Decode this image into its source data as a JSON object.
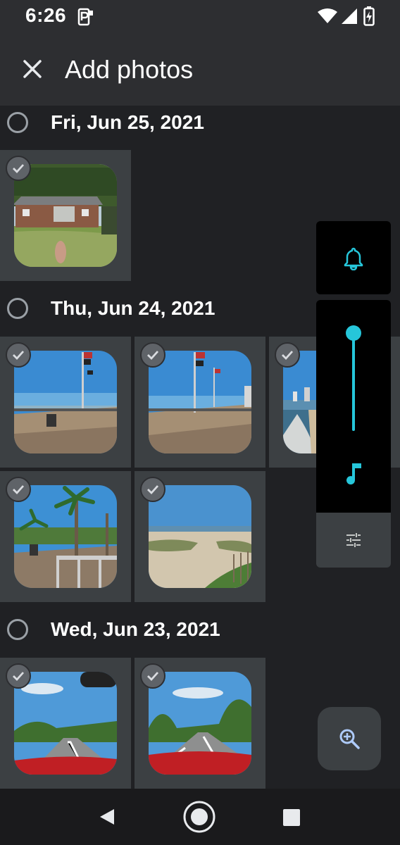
{
  "status_bar": {
    "time": "6:26",
    "icons": [
      "parking-notification-icon",
      "wifi-icon",
      "cell-signal-icon",
      "battery-charging-icon"
    ]
  },
  "app_bar": {
    "title": "Add photos",
    "close_icon": "close-icon"
  },
  "sections": [
    {
      "date": "Fri, Jun 25, 2021",
      "photos": [
        "house-yard-photo"
      ]
    },
    {
      "date": "Thu, Jun 24, 2021",
      "photos": [
        "boardwalk-flags-photo-1",
        "boardwalk-flags-photo-2",
        "beach-shore-photo",
        "boardwalk-palms-photo",
        "beach-path-photo"
      ]
    },
    {
      "date": "Wed, Jun 23, 2021",
      "photos": [
        "highway-drive-photo-1",
        "highway-drive-photo-2"
      ]
    }
  ],
  "volume_panel": {
    "ringer_icon": "bell-icon",
    "media_icon": "music-note-icon",
    "settings_icon": "sliders-icon",
    "media_level": 1.0,
    "accent": "#26c6da"
  },
  "fab": {
    "icon": "zoom-in-icon"
  },
  "nav_bar": {
    "icons": [
      "back-icon",
      "home-icon",
      "recents-icon"
    ]
  },
  "colors": {
    "background": "#202124",
    "bar": "#2d2e31",
    "tile": "#3c4043",
    "accent": "#26c6da"
  }
}
